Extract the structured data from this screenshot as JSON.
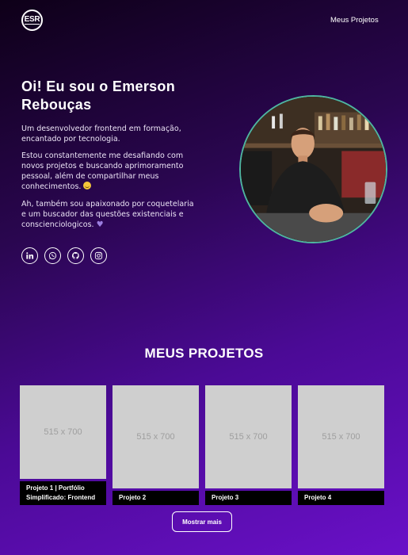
{
  "header": {
    "logo_text": "ESR",
    "nav_link": "Meus Projetos"
  },
  "hero": {
    "title": "Oi! Eu sou o Emerson Rebouças",
    "paragraph1": "Um desenvolvedor frontend em formação, encantado por tecnologia.",
    "paragraph2": "Estou constantemente me desafiando com novos projetos e buscando aprimoramento pessoal, além de compartilhar meus conhecimentos.",
    "paragraph3": "Ah, também sou apaixonado por coquetelaria e um buscador das questões existenciais e conscienciologicos.",
    "socials": [
      "linkedin-icon",
      "whatsapp-icon",
      "github-icon",
      "instagram-icon"
    ],
    "accent_ring_color": "#4fb6a0"
  },
  "projects": {
    "title": "MEUS PROJETOS",
    "items": [
      {
        "placeholder": "515 x 700",
        "caption": "Projeto 1 | Portfólio Simplificado: Frontend"
      },
      {
        "placeholder": "515 x 700",
        "caption": "Projeto 2"
      },
      {
        "placeholder": "515 x 700",
        "caption": "Projeto 3"
      },
      {
        "placeholder": "515 x 700",
        "caption": "Projeto 4"
      }
    ],
    "more_button": "Mostrar mais"
  }
}
